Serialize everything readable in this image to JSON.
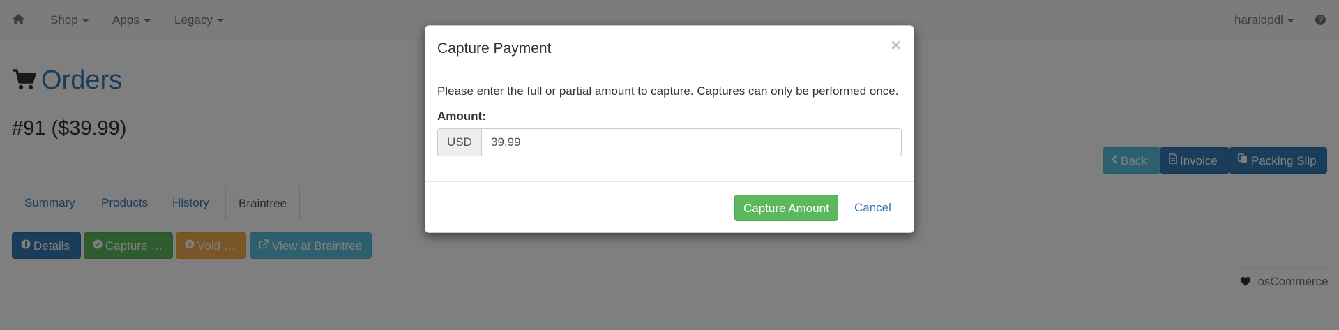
{
  "navbar": {
    "home_icon": "home-icon",
    "menus": [
      {
        "label": "Shop"
      },
      {
        "label": "Apps"
      },
      {
        "label": "Legacy"
      }
    ],
    "user": "haraldpdl",
    "help_icon": "question-circle-icon",
    "help_glyph": "?"
  },
  "page": {
    "title": "Orders",
    "title_icon": "shopping-cart-icon",
    "order_heading": "#91 ($39.99)"
  },
  "actions": {
    "back": "Back",
    "invoice": "Invoice",
    "packing_slip": "Packing Slip"
  },
  "tabs": [
    {
      "label": "Summary"
    },
    {
      "label": "Products"
    },
    {
      "label": "History"
    },
    {
      "label": "Braintree",
      "active": true
    }
  ],
  "braintree_buttons": {
    "details": "Details",
    "capture": "Capture …",
    "void": "Void …",
    "view": "View at Braintree"
  },
  "footer": {
    "text": ", osCommerce",
    "icon": "heart-icon"
  },
  "modal": {
    "title": "Capture Payment",
    "close_glyph": "×",
    "message": "Please enter the full or partial amount to capture. Captures can only be performed once.",
    "amount_label": "Amount:",
    "currency": "USD",
    "amount_value": "39.99",
    "capture_button": "Capture Amount",
    "cancel": "Cancel"
  },
  "colors": {
    "link": "#337ab7",
    "primary": "#337ab7",
    "info": "#5bc0de",
    "success": "#5cb85c",
    "warning": "#f0ad4e"
  }
}
